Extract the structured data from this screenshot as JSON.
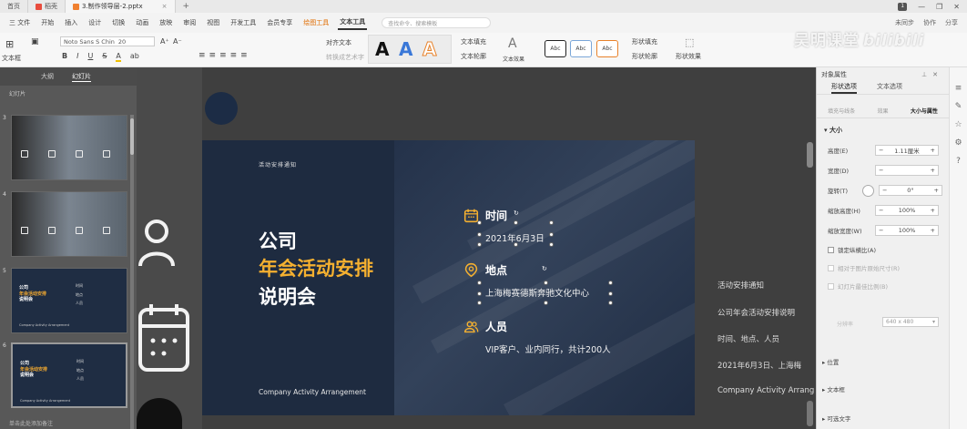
{
  "titlebar": {
    "tabs": [
      {
        "label": "首页",
        "color": "#ffffff"
      },
      {
        "label": "稻壳",
        "color": "#e84c3d"
      },
      {
        "label": "3.制作领导层-2.pptx",
        "color": "#f08030",
        "active": true
      }
    ],
    "close_glyph": "×",
    "plus_glyph": "+",
    "badge": "1",
    "controls": [
      "—",
      "❐",
      "✕"
    ]
  },
  "menubar": {
    "items": [
      "三 文件",
      "开始",
      "插入",
      "设计",
      "切换",
      "动画",
      "放映",
      "审阅",
      "视图",
      "开发工具",
      "会员专享",
      "绘图工具",
      "文本工具"
    ],
    "highlight_item": "绘图工具",
    "active_item": "文本工具",
    "search_placeholder": "查找命令、搜索模板",
    "right_items": [
      "未同步",
      "协作",
      "分享"
    ]
  },
  "ribbon": {
    "text_edit": "文本框",
    "font_name": "Noto Sans S Chin",
    "font_size": "20",
    "format_buttons": [
      "B",
      "I",
      "U",
      "S",
      "A",
      "ab"
    ],
    "align_text": "对齐文本",
    "convert_art": "转换成艺术字",
    "text_fill": "文本填充",
    "text_outline": "文本轮廓",
    "text_effect": "文本效果",
    "shape_fill": "形状填充",
    "shape_outline": "形状轮廓",
    "shape_effect": "形状效果",
    "style_sample": "Abc",
    "art_letters": [
      "A",
      "A",
      "A"
    ]
  },
  "watermark": {
    "text": "吴明课堂",
    "logo": "bilibili"
  },
  "leftpanel": {
    "tabs": [
      "大纲",
      "幻灯片"
    ],
    "active_tab": "幻灯片",
    "subheader": "幻灯片",
    "bottom_label": "单击此处添加备注",
    "slides": [
      {
        "num": "3",
        "kind": "photo"
      },
      {
        "num": "4",
        "kind": "photo"
      },
      {
        "num": "5",
        "kind": "dark",
        "title_a": "公司",
        "title_b": "年会活动安排",
        "title_c": "说明会",
        "items": [
          "时间",
          "地点",
          "人员"
        ],
        "foot": "Company Activity Arrangement"
      },
      {
        "num": "6",
        "kind": "dark",
        "selected": true,
        "title_a": "公司",
        "title_b": "年会活动安排",
        "title_c": "说明会",
        "items": [
          "时间",
          "地点",
          "人员"
        ],
        "foot": "Company Activity Arrangement"
      }
    ]
  },
  "slide": {
    "label_top": "活动安排通知",
    "title_line1": "公司",
    "title_line2": "年会活动安排",
    "title_line3": "说明会",
    "footer": "Company Activity Arrangement",
    "accent_color": "#f4b030",
    "time_label": "时间",
    "time_value": "2021年6月3日",
    "place_label": "地点",
    "place_value": "上海梅赛德斯奔驰文化中心",
    "people_label": "人员",
    "people_value": "VIP客户、业内同行，共计200人"
  },
  "notes": [
    "活动安排通知",
    "公司年会活动安排说明",
    "时间、地点、人员",
    "2021年6月3日、上海梅",
    "Company Activity Arrang"
  ],
  "prop": {
    "title": "对象属性",
    "tabs": [
      "形状选项",
      "文本选项"
    ],
    "active_tab": "形状选项",
    "subtabs": [
      "填充与线条",
      "效果",
      "大小与属性"
    ],
    "active_subtab": "大小与属性",
    "section_size": "大小",
    "height_label": "高度(E)",
    "height_value": "1.11厘米",
    "width_label": "宽度(D)",
    "width_value": "",
    "rotate_label": "旋转(T)",
    "rotate_value": "0°",
    "scale_h_label": "缩放高度(H)",
    "scale_h_value": "100%",
    "scale_w_label": "缩放宽度(W)",
    "scale_w_value": "100%",
    "lock_label": "锁定纵横比(A)",
    "relative_label": "相对于图片原始尺寸(R)",
    "best_label": "幻灯片最佳比例(B)",
    "res_label": "分辨率",
    "res_value": "640 x 480",
    "collapse_items": [
      "位置",
      "文本框",
      "可选文字"
    ]
  },
  "strip_icons": [
    "≡",
    "✎",
    "☆",
    "⚙",
    "?"
  ]
}
